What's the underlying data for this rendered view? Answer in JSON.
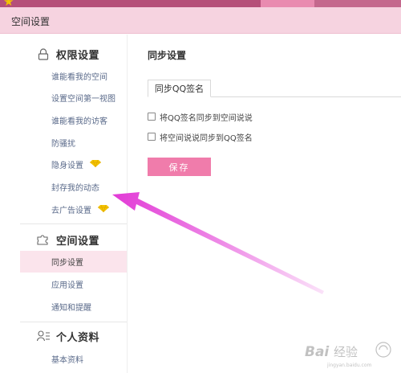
{
  "window": {
    "title": "空间设置"
  },
  "sidebar": {
    "sections": [
      {
        "label": "权限设置",
        "icon": "lock-icon",
        "items": [
          {
            "label": "谁能看我的空间"
          },
          {
            "label": "设置空间第一视图"
          },
          {
            "label": "谁能看我的访客"
          },
          {
            "label": "防骚扰"
          },
          {
            "label": "隐身设置",
            "badge": "diamond-icon"
          },
          {
            "label": "封存我的动态"
          },
          {
            "label": "去广告设置",
            "badge": "diamond-icon"
          }
        ]
      },
      {
        "label": "空间设置",
        "icon": "puzzle-icon",
        "items": [
          {
            "label": "同步设置",
            "active": true
          },
          {
            "label": "应用设置"
          },
          {
            "label": "通知和提醒"
          }
        ]
      },
      {
        "label": "个人资料",
        "icon": "user-list-icon",
        "items": [
          {
            "label": "基本资料"
          }
        ]
      }
    ]
  },
  "content": {
    "title": "同步设置",
    "tab_label": "同步QQ签名",
    "options": [
      {
        "label": "将QQ签名同步到空间说说",
        "checked": false
      },
      {
        "label": "将空间说说同步到QQ签名",
        "checked": false
      }
    ],
    "save_label": "保存"
  },
  "colors": {
    "accent": "#f07cab",
    "title_bar": "#f6d3e0",
    "active_item": "#fbe4ec",
    "annotation_arrow": "#e23ad6",
    "diamond": "#f4c400"
  }
}
